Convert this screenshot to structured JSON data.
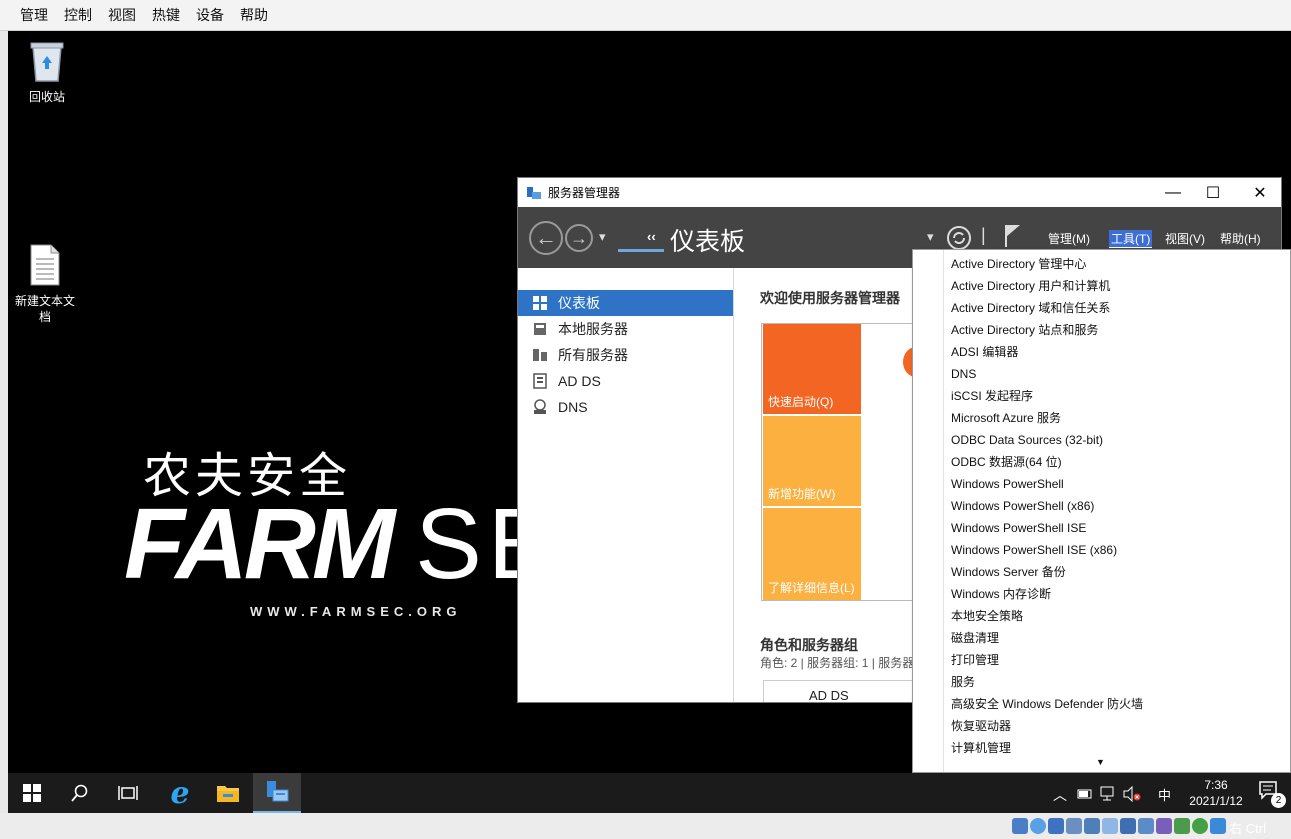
{
  "vm_menu": [
    "管理",
    "控制",
    "视图",
    "热键",
    "设备",
    "帮助"
  ],
  "desktop": {
    "icons": [
      {
        "label": "回收站"
      },
      {
        "label": "新建文本文\n档"
      }
    ],
    "wallpaper": {
      "logo_cn": "农夫安全",
      "logo_main": "FARM",
      "logo_tail": "SE",
      "logo_url": "WWW.FARMSEC.ORG"
    }
  },
  "server_manager": {
    "title": "服务器管理器",
    "window_controls": {
      "minimize": "—",
      "maximize": "☐",
      "close": "✕"
    },
    "header": {
      "page_title": "仪表板",
      "breadcrumb_arrows": "‹‹",
      "menus": [
        {
          "label": "管理(M)",
          "selected": false
        },
        {
          "label": "工具(T)",
          "selected": true
        },
        {
          "label": "视图(V)",
          "selected": false
        },
        {
          "label": "帮助(H)",
          "selected": false
        }
      ]
    },
    "sidebar": {
      "items": [
        {
          "label": "仪表板",
          "active": true
        },
        {
          "label": "本地服务器",
          "active": false
        },
        {
          "label": "所有服务器",
          "active": false
        },
        {
          "label": "AD DS",
          "active": false
        },
        {
          "label": "DNS",
          "active": false
        }
      ]
    },
    "content": {
      "welcome": "欢迎使用服务器管理器",
      "tiles": [
        {
          "label": "快速启动(Q)",
          "color": "#f26522"
        },
        {
          "label": "新增功能(W)",
          "color": "#fbb040"
        },
        {
          "label": "了解详细信息(L)",
          "color": "#fbb040"
        }
      ],
      "roles_title": "角色和服务器组",
      "roles_sub": "角色: 2 | 服务器组: 1 | 服务器",
      "role_card": "AD DS"
    }
  },
  "tools_menu": {
    "items": [
      "Active Directory 管理中心",
      "Active Directory 用户和计算机",
      "Active Directory 域和信任关系",
      "Active Directory 站点和服务",
      "ADSI 编辑器",
      "DNS",
      "iSCSI 发起程序",
      "Microsoft Azure 服务",
      "ODBC Data Sources (32-bit)",
      "ODBC 数据源(64 位)",
      "Windows PowerShell",
      "Windows PowerShell (x86)",
      "Windows PowerShell ISE",
      "Windows PowerShell ISE (x86)",
      "Windows Server 备份",
      "Windows 内存诊断",
      "本地安全策略",
      "磁盘清理",
      "打印管理",
      "服务",
      "高级安全 Windows Defender 防火墙",
      "恢复驱动器",
      "计算机管理"
    ],
    "scroll_indicator": "▼"
  },
  "taskbar": {
    "ime": "中",
    "time": "7:36",
    "date": "2021/1/12",
    "notification_count": "2"
  },
  "vm_status": {
    "host_key": "右 Ctrl"
  },
  "colors": {
    "accent": "#2e73c6",
    "header_bg": "#444444",
    "tile_orange": "#f26522",
    "tile_amber": "#fbb040"
  }
}
